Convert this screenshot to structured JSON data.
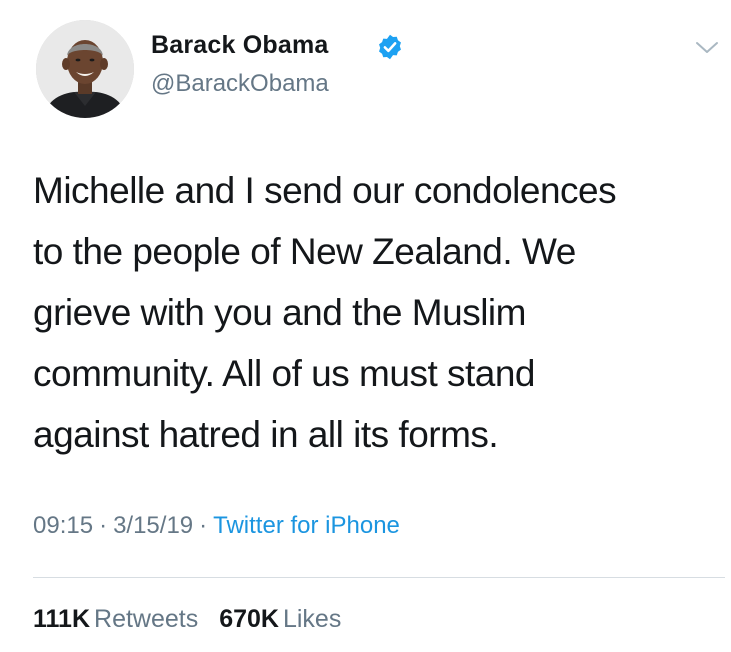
{
  "author": {
    "name": "Barack Obama",
    "handle": "@BarackObama",
    "verified": true,
    "avatar": "profile-photo"
  },
  "tweet": {
    "lines": [
      "Michelle and I send our condolences",
      "to the people of New Zealand. We",
      "grieve with you and the Muslim",
      "community. All of us must stand",
      "against hatred in all its forms."
    ]
  },
  "meta": {
    "time": "09:15",
    "date": "3/15/19",
    "separator": "·",
    "source": "Twitter for iPhone"
  },
  "stats": {
    "retweets_count": "111K",
    "retweets_label": "Retweets",
    "likes_count": "670K",
    "likes_label": "Likes"
  },
  "colors": {
    "text": "#14171a",
    "secondary": "#657786",
    "link": "#1b95e0",
    "verified": "#1da1f2",
    "divider": "#d7dde2"
  },
  "icons": {
    "verified": "verified-badge-icon",
    "menu": "chevron-down-icon"
  }
}
